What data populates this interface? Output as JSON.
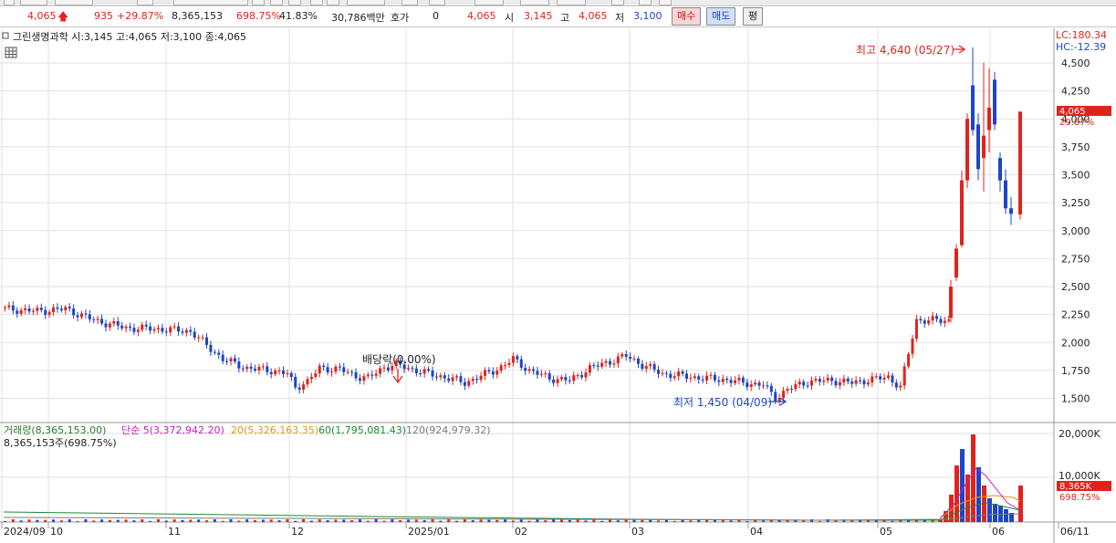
{
  "quote_bar": {
    "price": "4,065",
    "change": "935",
    "change_pct": "+29.87%",
    "volume": "8,365,153",
    "volume_ratio": "698.75%",
    "turnover_pct": "41.83%",
    "trade_value": "30,786백만",
    "bid_label": "호가",
    "bid_value": "0",
    "bid_price": "4,065",
    "open_label": "시",
    "open": "3,145",
    "high_label": "고",
    "high": "4,065",
    "low_label": "저",
    "low": "3,100",
    "buy_label": "매수",
    "sell_label": "매도",
    "avg_label": "평"
  },
  "chart": {
    "title": "그린생명과학 시:3,145 고:4,065 저:3,100 종:4,065",
    "lc_label": "LC:180.34",
    "hc_label": "HC:-12.39",
    "last_price_label": "4,065",
    "last_pct_label": "29.87%",
    "high_annotation": "최고 4,640 (05/27)",
    "low_annotation": "최저 1,450 (04/09)",
    "dividend_annotation": "배당락(0.00%)",
    "price_ticks": [
      "4,500",
      "4,250",
      "4,000",
      "3,750",
      "3,500",
      "3,250",
      "3,000",
      "2,750",
      "2,500",
      "2,250",
      "2,000",
      "1,750",
      "1,500"
    ],
    "date_labels": [
      "2024/09",
      "10",
      "11",
      "12",
      "2025/01",
      "02",
      "03",
      "04",
      "05",
      "06",
      "06/11"
    ],
    "volume_legend": {
      "volume": "거래량(8,365,153.00)",
      "ma5": "단순 5(3,372,942.20)",
      "ma20": "20(5,326,163.35)",
      "ma60": "60(1,795,081.43)",
      "ma120": "120(924,979.32)",
      "sub": "8,365,153주(698.75%)"
    },
    "volume_ticks": [
      "20,000K",
      "10,000K"
    ],
    "last_volume_label": "8,365K",
    "last_volume_pct": "698.75%",
    "colors": {
      "up": "#e0241c",
      "down": "#1d45c9",
      "ma5": "#c21fc4",
      "ma20": "#e09a10",
      "ma60": "#1e8c2c",
      "ma120": "#7a7a7a",
      "grid": "#e2e2e2"
    }
  },
  "chart_data": {
    "type": "candlestick",
    "title": "그린생명과학",
    "y_range": [
      1350,
      4750
    ],
    "x_range": [
      "2024/09",
      "06/11"
    ],
    "key_points": [
      {
        "date": "2024/09",
        "close": 2300
      },
      {
        "date": "10",
        "close": 2280
      },
      {
        "date": "11",
        "close": 2130
      },
      {
        "date": "12",
        "close": 1550
      },
      {
        "date": "2025/01",
        "close": 1800
      },
      {
        "date": "02",
        "close": 1650
      },
      {
        "date": "03",
        "close": 1750
      },
      {
        "date": "04",
        "close": 1600
      },
      {
        "date": "04/09",
        "low": 1450
      },
      {
        "date": "05",
        "close": 1660
      },
      {
        "date": "05/27",
        "high": 4640
      },
      {
        "date": "06/11",
        "open": 3145,
        "high": 4065,
        "low": 3100,
        "close": 4065
      }
    ],
    "volume_series": [
      {
        "name": "거래량",
        "last": 8365153
      },
      {
        "name": "단순 5",
        "last": 3372942.2
      },
      {
        "name": "20",
        "last": 5326163.35
      },
      {
        "name": "60",
        "last": 1795081.43
      },
      {
        "name": "120",
        "last": 924979.32
      }
    ]
  }
}
